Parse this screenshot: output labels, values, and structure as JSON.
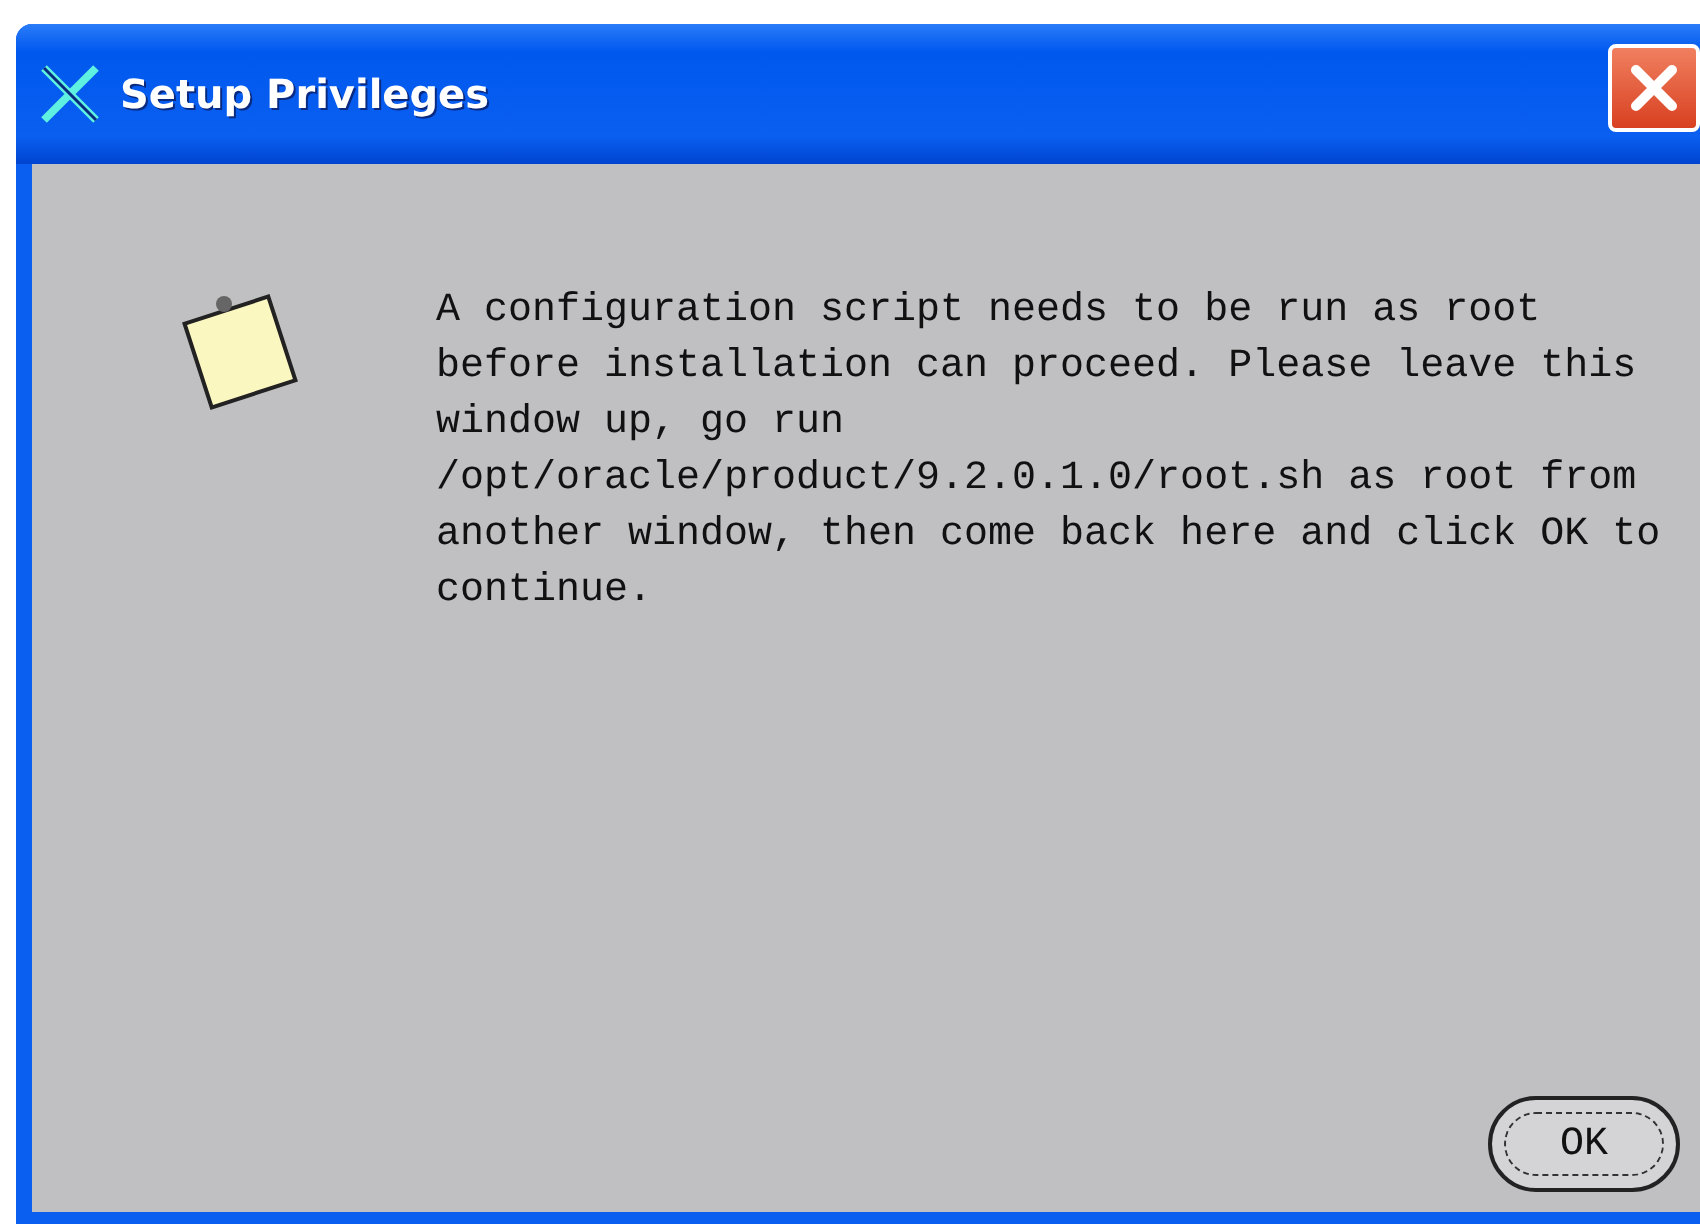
{
  "window": {
    "title": "Setup Privileges"
  },
  "message_lines": [
    "A configuration script needs to be run as root",
    "before installation can proceed. Please leave this",
    "window up, go run",
    "/opt/oracle/product/9.2.0.1.0/root.sh as root from",
    "another window, then come back here and click OK to",
    "continue."
  ],
  "buttons": [
    {
      "label": "OK"
    }
  ]
}
